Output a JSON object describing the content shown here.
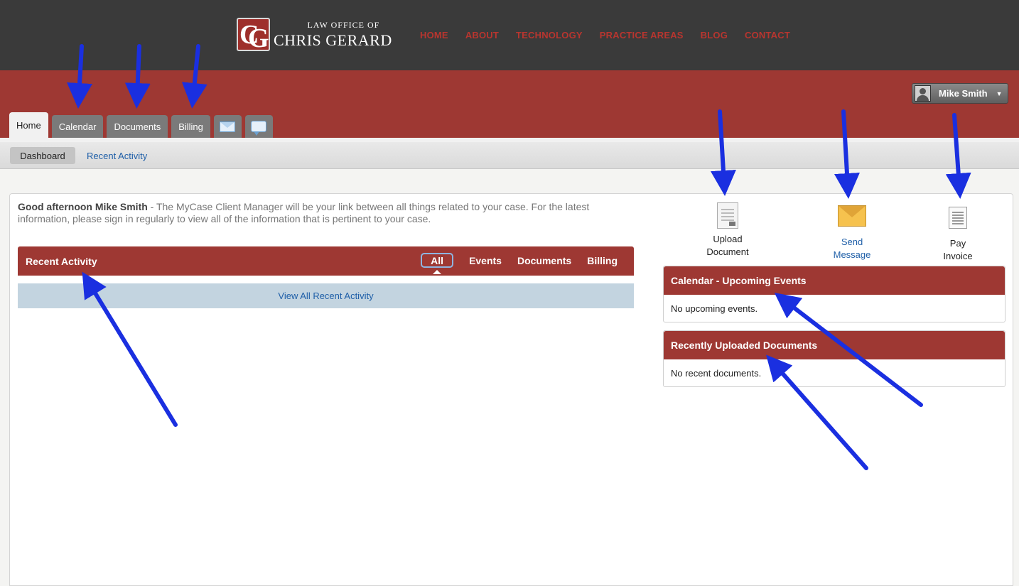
{
  "header": {
    "logo_small": "LAW OFFICE OF",
    "logo_big": "CHRIS GERARD",
    "logo_monogram": "CG",
    "nav": [
      "HOME",
      "ABOUT",
      "TECHNOLOGY",
      "PRACTICE AREAS",
      "BLOG",
      "CONTACT"
    ]
  },
  "user_menu": {
    "name": "Mike Smith",
    "icon": "avatar-icon"
  },
  "tabs": [
    {
      "label": "Home",
      "active": true
    },
    {
      "label": "Calendar"
    },
    {
      "label": "Documents"
    },
    {
      "label": "Billing"
    }
  ],
  "tab_icons": [
    "envelope-icon",
    "chat-bubble-icon"
  ],
  "subnav": {
    "dashboard": "Dashboard",
    "recent_activity": "Recent Activity"
  },
  "greeting": {
    "bold": "Good afternoon Mike Smith",
    "text": " - The MyCase Client Manager will be your link between all things related to your case. For the latest information, please sign in regularly to view all of the information that is pertinent to your case."
  },
  "recent_activity": {
    "title": "Recent Activity",
    "filters": [
      "All",
      "Events",
      "Documents",
      "Billing"
    ],
    "selected_filter": "All",
    "view_all": "View All Recent Activity"
  },
  "quick_actions": {
    "upload": {
      "line1": "Upload",
      "line2": "Document",
      "icon": "document-icon"
    },
    "send": {
      "line1": "Send",
      "line2": "Message",
      "icon": "envelope-icon"
    },
    "pay": {
      "line1": "Pay",
      "line2": "Invoice",
      "icon": "invoice-icon"
    }
  },
  "calendar_widget": {
    "title": "Calendar - Upcoming Events",
    "empty": "No upcoming events."
  },
  "documents_widget": {
    "title": "Recently Uploaded Documents",
    "empty": "No recent documents."
  },
  "colors": {
    "header_bg": "#3a3a3a",
    "brand_red": "#9e3833",
    "nav_red": "#b8352f",
    "link_blue": "#1f5fa8",
    "arrow_blue": "#1a2fe0"
  }
}
